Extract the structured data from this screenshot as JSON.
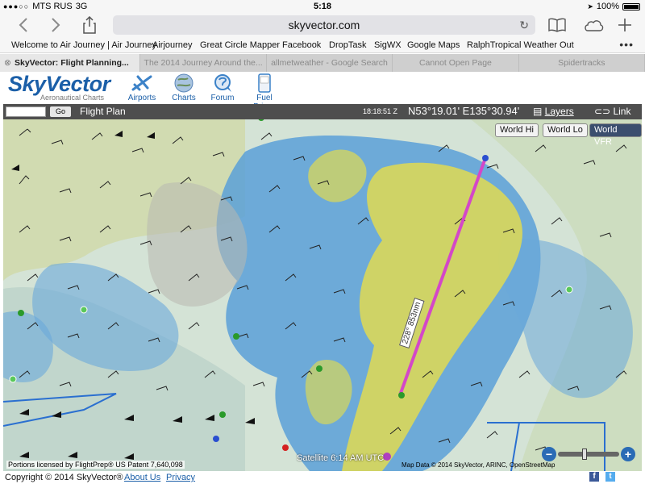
{
  "status": {
    "carrier": "MTS RUS",
    "network": "3G",
    "time": "5:18",
    "battery": "100%"
  },
  "browser": {
    "url": "skyvector.com",
    "bookmarks": [
      "Welcome to Air Journey | Air Journey",
      "Airjourney",
      "Great Circle Mapper",
      "Facebook",
      "DropTask",
      "SigWX",
      "Google Maps",
      "RalphTropical Weather Out"
    ],
    "tabs": [
      "SkyVector: Flight Planning...",
      "The 2014 Journey Around the...",
      "allmetweather - Google Search",
      "Cannot Open Page",
      "Spidertracks"
    ]
  },
  "site": {
    "logo": "SkyVector",
    "tagline": "Aeronautical Charts",
    "nav": [
      "Airports",
      "Charts",
      "Forum",
      "Fuel Prices"
    ],
    "fuel_icon_text": "TOOLS Jet A"
  },
  "toolbar": {
    "go_label": "Go",
    "flight_plan": "Flight Plan",
    "time": "18:18:51 Z",
    "coords": "N53°19.01' E135°30.94'",
    "layers": "Layers",
    "link": "Link"
  },
  "map": {
    "buttons": [
      "World Hi",
      "World Lo",
      "World VFR"
    ],
    "selected_button": "World VFR",
    "route_label": "228° 853nm",
    "sat_label": "Satellite 6:14 AM UTC",
    "license": "Portions licensed by FlightPrep® US Patent 7,640,098",
    "map_data": "Map Data © 2014 SkyVector, ARINC, OpenStreetMap",
    "zoom_minus": "−",
    "zoom_plus": "+"
  },
  "footer": {
    "copyright": "Copyright © 2014 SkyVector®",
    "about": "About Us",
    "privacy": "Privacy",
    "fb": "f",
    "tw": "t"
  },
  "colors": {
    "brand": "#1b5fa8",
    "route": "#d447c8",
    "toolbar": "#4e4e4e"
  }
}
